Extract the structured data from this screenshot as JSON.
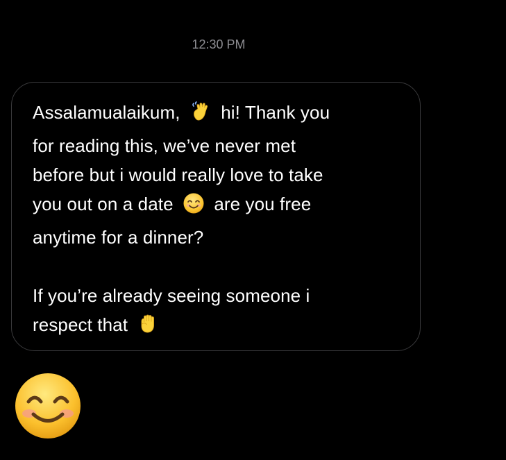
{
  "thread": {
    "timestamp": "12:30 PM"
  },
  "message": {
    "lines": [
      {
        "before": "Assalamualaikum,",
        "emoji": "waving-hand-icon",
        "after": "hi! Thank you"
      },
      {
        "text": "for reading this, we’ve never met"
      },
      {
        "text": "before but i would really love to take"
      },
      {
        "before": "you out on a date",
        "emoji": "smiling-face-icon",
        "after": "are you free"
      },
      {
        "text": "anytime for a dinner?"
      },
      {
        "text": "If you’re already seeing someone i"
      },
      {
        "before": "respect that",
        "emoji": "raised-fist-icon",
        "after": ""
      }
    ]
  },
  "reply": {
    "emoji": "smiling-face-icon"
  },
  "colors": {
    "background": "#000000",
    "text": "#ffffff",
    "timestamp": "#8e8e93",
    "bubble_border": "#3a3a3c",
    "emoji_yellow": "#fbd23a"
  }
}
